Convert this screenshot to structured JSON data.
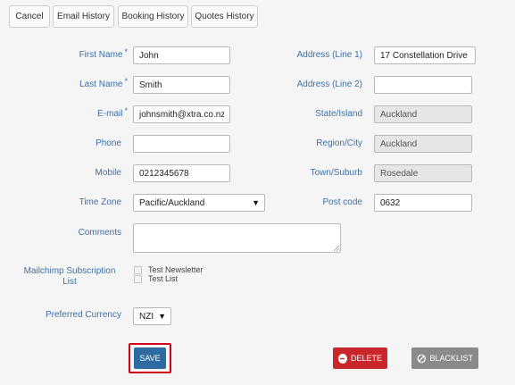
{
  "tabs": {
    "cancel": "Cancel",
    "email_history": "Email History",
    "booking_history": "Booking History",
    "quotes_history": "Quotes History"
  },
  "required_marker": "*",
  "form": {
    "first_name": {
      "label": "First Name",
      "value": "John"
    },
    "last_name": {
      "label": "Last Name",
      "value": "Smith"
    },
    "email": {
      "label": "E-mail",
      "value": "johnsmith@xtra.co.nz"
    },
    "phone": {
      "label": "Phone",
      "value": ""
    },
    "mobile": {
      "label": "Mobile",
      "value": "0212345678"
    },
    "time_zone": {
      "label": "Time Zone",
      "value": "Pacific/Auckland"
    },
    "comments": {
      "label": "Comments",
      "value": ""
    },
    "mailchimp": {
      "label_line1": "Mailchimp Subscription",
      "label_line2": "List",
      "options": [
        "Test Newsletter",
        "Test List"
      ]
    },
    "currency": {
      "label": "Preferred Currency",
      "value": "NZI"
    },
    "address1": {
      "label": "Address (Line 1)",
      "value": "17 Constellation Drive"
    },
    "address2": {
      "label": "Address (Line 2)",
      "value": ""
    },
    "state": {
      "label": "State/Island",
      "value": "Auckland"
    },
    "region": {
      "label": "Region/City",
      "value": "Auckland"
    },
    "town": {
      "label": "Town/Suburb",
      "value": "Rosedale"
    },
    "postcode": {
      "label": "Post code",
      "value": "0632"
    }
  },
  "buttons": {
    "save": "SAVE",
    "delete": "DELETE",
    "blacklist": "BLACKLIST"
  },
  "icons": {
    "delete": "minus-circle-icon",
    "blacklist": "ban-icon",
    "select": "dropdown-arrow-icon"
  },
  "colors": {
    "label": "#3d6fa8",
    "save": "#2c6aa0",
    "save_highlight": "#d0021b",
    "delete": "#c8262a",
    "blacklist": "#8a8a8a",
    "readonly_bg": "#e6e6e6"
  }
}
